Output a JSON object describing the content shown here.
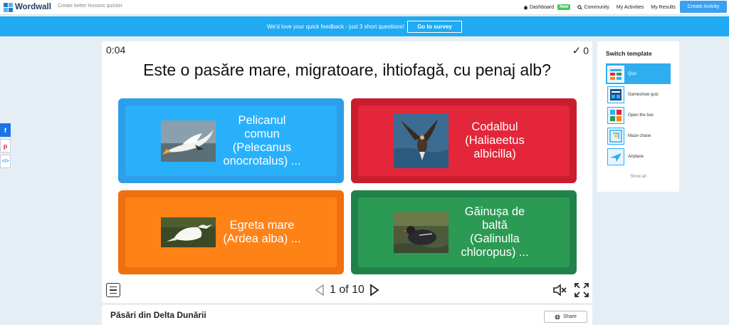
{
  "topbar": {
    "logo_text": "Wordwall",
    "tagline": "Create better lessons quicker",
    "nav": [
      {
        "label": "Dashboard",
        "icon": "home-icon"
      },
      {
        "label": "Community",
        "icon": "search-icon"
      },
      {
        "label": "My Activities"
      },
      {
        "label": "My Results"
      }
    ],
    "new_badge": "New",
    "create_label": "Create Activity"
  },
  "banner": {
    "text": "We'd love your quick feedback - just 3 short questions!",
    "button": "Go to survey"
  },
  "social": {
    "facebook": "f",
    "pinterest": "p",
    "embed": "</>"
  },
  "quiz": {
    "timer": "0:04",
    "score": "0",
    "question": "Este o pasăre mare, migratoare, ihtiofagă, cu penaj alb?",
    "answers": [
      {
        "label": "Pelicanul comun (Pelecanus onocrotalus) ..."
      },
      {
        "label": "Codalbul (Haliaeetus albicilla)"
      },
      {
        "label": "Egreta mare (Ardea alba) ..."
      },
      {
        "label": "Găinușa de baltă (Galinulla chloropus) ..."
      }
    ],
    "pager": "1 of 10"
  },
  "activity_title": "Păsări din Delta Dunării",
  "share_label": "Share",
  "switch_panel": {
    "title": "Switch template",
    "templates": [
      {
        "label": "Quiz",
        "active": true
      },
      {
        "label": "Gameshow quiz",
        "active": false
      },
      {
        "label": "Open the box",
        "active": false
      },
      {
        "label": "Maze chase",
        "active": false
      },
      {
        "label": "Airplane",
        "active": false
      }
    ],
    "show_all": "Show all"
  },
  "colors": {
    "brand": "#1faaf1",
    "blue": "#29b0fb",
    "red": "#e32639",
    "orange": "#ff8217",
    "green": "#2b9a55"
  }
}
